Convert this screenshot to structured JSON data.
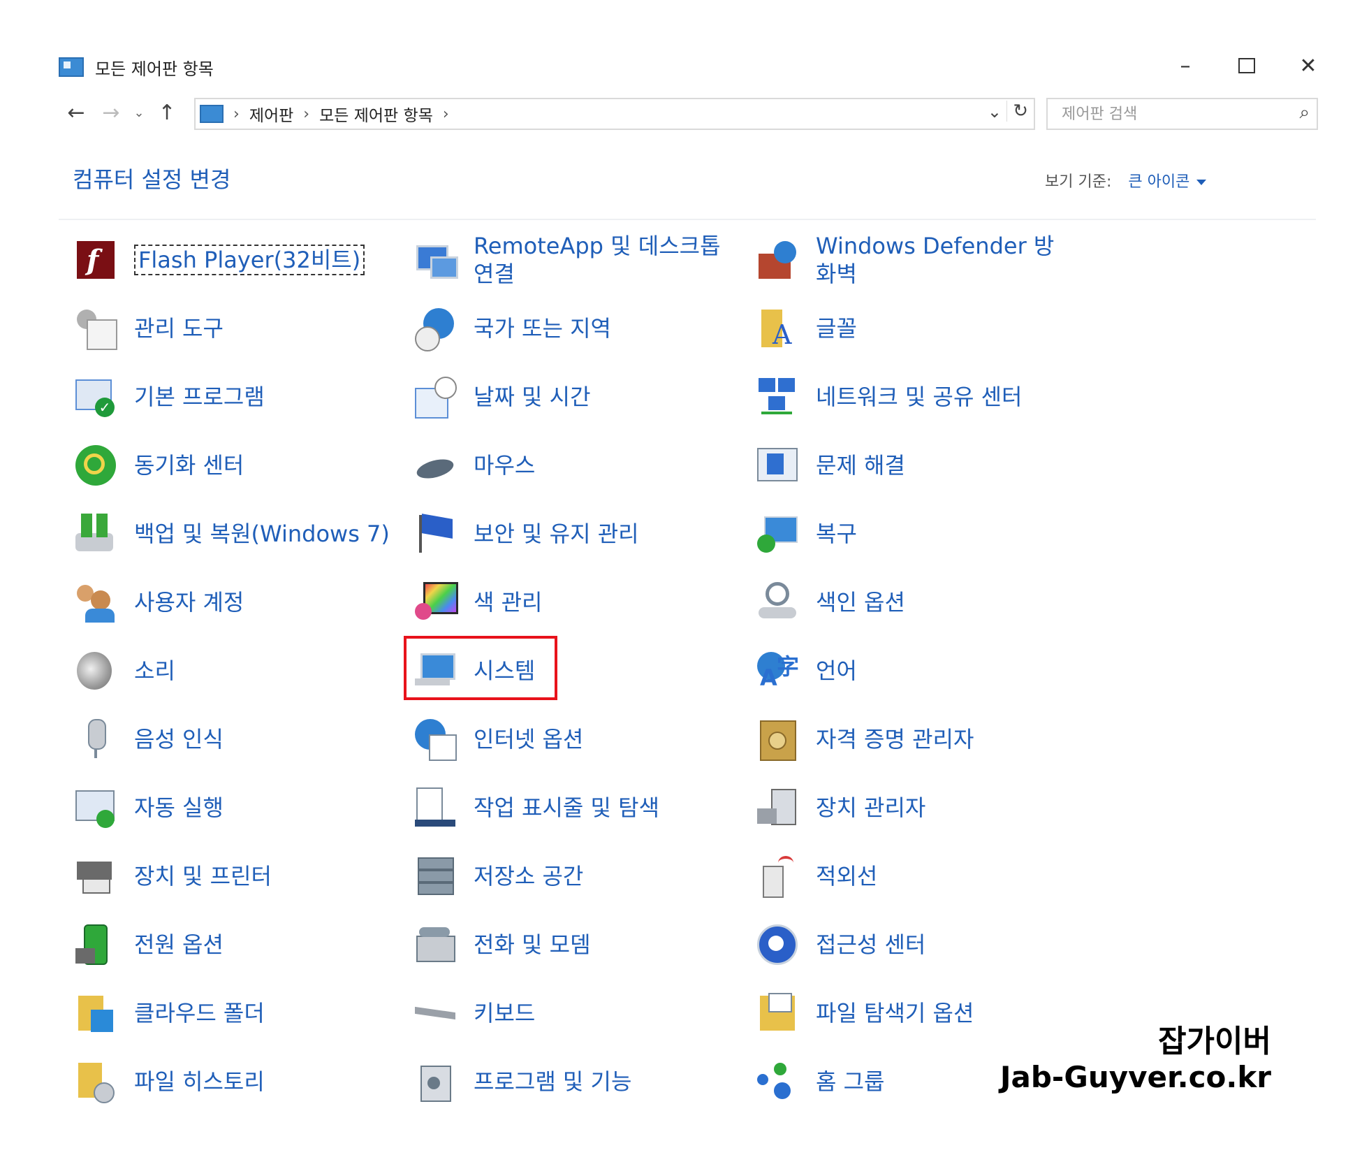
{
  "window": {
    "title": "모든 제어판 항목"
  },
  "address": {
    "crumbs": [
      "제어판",
      "모든 제어판 항목"
    ]
  },
  "search": {
    "placeholder": "제어판 검색"
  },
  "heading": "컴퓨터 설정 변경",
  "view": {
    "label": "보기 기준:",
    "value": "큰 아이콘"
  },
  "items": [
    {
      "label": "Flash Player(32비트)",
      "icon": "flash-icon",
      "color": "#7a0f14"
    },
    {
      "label": "RemoteApp 및 데스크톱 연결",
      "icon": "remote-desktop-icon",
      "color": "#3a7bd5"
    },
    {
      "label": "Windows Defender 방화벽",
      "icon": "firewall-icon",
      "color": "#b5462f"
    },
    {
      "label": "관리 도구",
      "icon": "admin-tools-icon",
      "color": "#8a8a8a"
    },
    {
      "label": "국가 또는 지역",
      "icon": "globe-clock-icon",
      "color": "#2e7fd1"
    },
    {
      "label": "글꼴",
      "icon": "font-folder-icon",
      "color": "#e8c14a"
    },
    {
      "label": "기본 프로그램",
      "icon": "default-programs-icon",
      "color": "#1f9a3a"
    },
    {
      "label": "날짜 및 시간",
      "icon": "calendar-clock-icon",
      "color": "#5c8fd6"
    },
    {
      "label": "네트워크 및 공유 센터",
      "icon": "network-icon",
      "color": "#2f6fd0"
    },
    {
      "label": "동기화 센터",
      "icon": "sync-icon",
      "color": "#2fa83a"
    },
    {
      "label": "마우스",
      "icon": "mouse-icon",
      "color": "#5a6a7a"
    },
    {
      "label": "문제 해결",
      "icon": "troubleshoot-icon",
      "color": "#2f6fd0"
    },
    {
      "label": "백업 및 복원(Windows 7)",
      "icon": "backup-icon",
      "color": "#3aa83a"
    },
    {
      "label": "보안 및 유지 관리",
      "icon": "flag-icon",
      "color": "#2a5fc8"
    },
    {
      "label": "복구",
      "icon": "recovery-icon",
      "color": "#3a8ad8"
    },
    {
      "label": "사용자 계정",
      "icon": "users-icon",
      "color": "#d9a06a"
    },
    {
      "label": "색 관리",
      "icon": "color-management-icon",
      "color": "#e04a8a"
    },
    {
      "label": "색인 옵션",
      "icon": "indexing-icon",
      "color": "#7a8a9a"
    },
    {
      "label": "소리",
      "icon": "speaker-icon",
      "color": "#9a9a9a"
    },
    {
      "label": "시스템",
      "icon": "system-monitor-icon",
      "color": "#3a8ad8"
    },
    {
      "label": "언어",
      "icon": "language-icon",
      "color": "#2a6fd0"
    },
    {
      "label": "음성 인식",
      "icon": "microphone-icon",
      "color": "#9aa0a8"
    },
    {
      "label": "인터넷 옵션",
      "icon": "internet-options-icon",
      "color": "#2e7fd1"
    },
    {
      "label": "자격 증명 관리자",
      "icon": "credential-vault-icon",
      "color": "#c9a24a"
    },
    {
      "label": "자동 실행",
      "icon": "autoplay-icon",
      "color": "#2fa83a"
    },
    {
      "label": "작업 표시줄 및 탐색",
      "icon": "taskbar-icon",
      "color": "#2a4a7a"
    },
    {
      "label": "장치 관리자",
      "icon": "device-manager-icon",
      "color": "#6a6a6a"
    },
    {
      "label": "장치 및 프린터",
      "icon": "printer-icon",
      "color": "#6a6a6a"
    },
    {
      "label": "저장소 공간",
      "icon": "storage-spaces-icon",
      "color": "#8a9aa8"
    },
    {
      "label": "적외선",
      "icon": "infrared-icon",
      "color": "#d83a3a"
    },
    {
      "label": "전원 옵션",
      "icon": "power-options-icon",
      "color": "#2fa83a"
    },
    {
      "label": "전화 및 모뎀",
      "icon": "phone-modem-icon",
      "color": "#8a9aa8"
    },
    {
      "label": "접근성 센터",
      "icon": "accessibility-icon",
      "color": "#2a5fc8"
    },
    {
      "label": "클라우드 폴더",
      "icon": "cloud-folder-icon",
      "color": "#e8c14a"
    },
    {
      "label": "키보드",
      "icon": "keyboard-icon",
      "color": "#9aa0a8"
    },
    {
      "label": "파일 탐색기 옵션",
      "icon": "folder-options-icon",
      "color": "#e8c14a"
    },
    {
      "label": "파일 히스토리",
      "icon": "file-history-icon",
      "color": "#e8c14a"
    },
    {
      "label": "프로그램 및 기능",
      "icon": "programs-features-icon",
      "color": "#8a9aa8"
    },
    {
      "label": "홈 그룹",
      "icon": "homegroup-icon",
      "color": "#2a6fd0"
    }
  ],
  "watermark": {
    "line1": "잡가이버",
    "line2": "Jab-Guyver.co.kr"
  }
}
